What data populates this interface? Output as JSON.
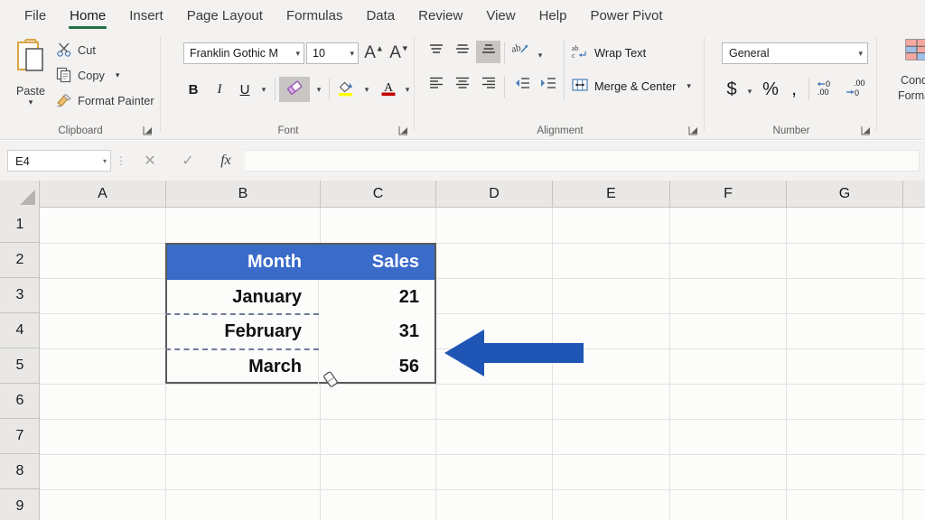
{
  "app": {
    "name": "Microsoft Excel",
    "accent_green": "#217346",
    "ribbon_bg": "#f3f2f1"
  },
  "tabs": [
    {
      "label": "File",
      "active": false
    },
    {
      "label": "Home",
      "active": true
    },
    {
      "label": "Insert",
      "active": false
    },
    {
      "label": "Page Layout",
      "active": false
    },
    {
      "label": "Formulas",
      "active": false
    },
    {
      "label": "Data",
      "active": false
    },
    {
      "label": "Review",
      "active": false
    },
    {
      "label": "View",
      "active": false
    },
    {
      "label": "Help",
      "active": false
    },
    {
      "label": "Power Pivot",
      "active": false
    }
  ],
  "ribbon": {
    "clipboard": {
      "group_label": "Clipboard",
      "paste_label": "Paste",
      "items": [
        {
          "label": "Cut",
          "icon": "scissors-icon",
          "has_caret": false
        },
        {
          "label": "Copy",
          "icon": "copy-icon",
          "has_caret": true
        },
        {
          "label": "Format Painter",
          "icon": "paintbrush-icon",
          "has_caret": false
        }
      ]
    },
    "font": {
      "group_label": "Font",
      "font_name": "Franklin Gothic M",
      "font_size": "10",
      "grow_label": "A",
      "shrink_label": "A",
      "bold_label": "B",
      "italic_label": "I",
      "underline_label": "U",
      "borders_icon": "erase-border-icon",
      "borders_active": true,
      "fill_color_icon": "fill-color-icon",
      "font_color_icon": "font-color-icon",
      "font_color_swatch": "#c00000",
      "fill_color_swatch": "#ffff00"
    },
    "alignment": {
      "group_label": "Alignment",
      "top_align_icon": "align-top-icon",
      "middle_align_icon": "align-middle-icon",
      "bottom_align_icon": "align-bottom-icon",
      "bottom_align_active": true,
      "orientation_icon": "text-orientation-icon",
      "align_left_icon": "align-left-icon",
      "align_center_icon": "align-center-icon",
      "align_right_icon": "align-right-icon",
      "decrease_indent_icon": "decrease-indent-icon",
      "increase_indent_icon": "increase-indent-icon",
      "wrap_text_label": "Wrap Text",
      "wrap_text_icon": "wrap-text-icon",
      "merge_center_label": "Merge & Center",
      "merge_center_icon": "merge-cells-icon"
    },
    "number": {
      "group_label": "Number",
      "format": "General",
      "currency_label": "$",
      "percent_label": "%",
      "comma_label": ",",
      "increase_decimal_icon": "increase-decimal-icon",
      "decrease_decimal_icon": "decrease-decimal-icon"
    },
    "styles": {
      "conditional_formatting_line1": "Cond",
      "conditional_formatting_line2": "Forma",
      "icon": "conditional-formatting-icon"
    }
  },
  "formula_bar": {
    "name_box": "E4",
    "cancel_icon": "cancel-x-icon",
    "enter_icon": "confirm-check-icon",
    "function_icon": "fx-icon",
    "formula_value": "",
    "formula_placeholder": ""
  },
  "grid": {
    "columns": [
      "A",
      "B",
      "C",
      "D",
      "E",
      "F",
      "G"
    ],
    "rows": [
      "1",
      "2",
      "3",
      "4",
      "5",
      "6",
      "7",
      "8",
      "9"
    ],
    "selected_cell": "E4"
  },
  "table": {
    "header_bg": "#3b6bc9",
    "header_text_color": "#ffffff",
    "border_color": "#5a5a5a",
    "headers": [
      "Month",
      "Sales"
    ],
    "rows": [
      {
        "month": "January",
        "sales": "21"
      },
      {
        "month": "February",
        "sales": "31"
      },
      {
        "month": "March",
        "sales": "56"
      }
    ],
    "erased_border_style": "dashed",
    "erased_border_color": "#6f7b96"
  },
  "annotations": {
    "arrow": {
      "name": "pointer-arrow",
      "direction": "left",
      "color": "#1f55b5"
    },
    "cursor": {
      "name": "eraser-cursor",
      "tool": "erase-border"
    }
  }
}
